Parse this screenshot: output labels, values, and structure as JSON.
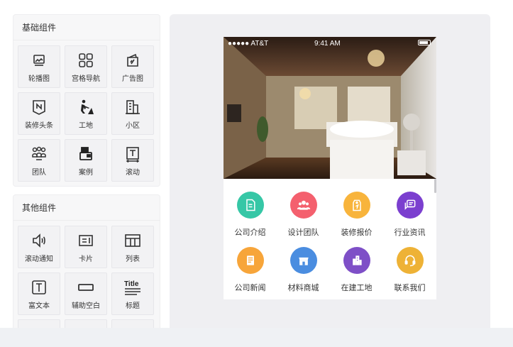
{
  "sidebar": {
    "basic": {
      "title": "基础组件",
      "items": [
        {
          "label": "轮播图",
          "icon": "carousel-icon"
        },
        {
          "label": "宫格导航",
          "icon": "grid-nav-icon"
        },
        {
          "label": "广告图",
          "icon": "ad-image-icon"
        },
        {
          "label": "装修头条",
          "icon": "headline-icon"
        },
        {
          "label": "工地",
          "icon": "construction-worker-icon"
        },
        {
          "label": "小区",
          "icon": "building-icon"
        },
        {
          "label": "团队",
          "icon": "team-icon"
        },
        {
          "label": "案例",
          "icon": "case-icon"
        },
        {
          "label": "滚动",
          "icon": "scroll-text-icon"
        }
      ]
    },
    "other": {
      "title": "其他组件",
      "items": [
        {
          "label": "滚动通知",
          "icon": "speaker-icon"
        },
        {
          "label": "卡片",
          "icon": "card-icon"
        },
        {
          "label": "列表",
          "icon": "list-layout-icon"
        },
        {
          "label": "富文本",
          "icon": "rich-text-icon"
        },
        {
          "label": "辅助空白",
          "icon": "blank-space-icon"
        },
        {
          "label": "标题",
          "icon": "title-icon"
        }
      ]
    }
  },
  "preview": {
    "status_bar": {
      "carrier": "●●●●● AT&T",
      "time": "9:41 AM"
    },
    "nav_items": [
      {
        "label": "公司介绍",
        "color": "#36c7a6",
        "icon": "document-icon"
      },
      {
        "label": "设计团队",
        "color": "#f4606e",
        "icon": "users-icon"
      },
      {
        "label": "装修报价",
        "color": "#f8b43c",
        "icon": "price-tag-icon"
      },
      {
        "label": "行业资讯",
        "color": "#7b3fcf",
        "icon": "chat-icon"
      },
      {
        "label": "公司新闻",
        "color": "#f7a53a",
        "icon": "newspaper-icon"
      },
      {
        "label": "材料商城",
        "color": "#4a8de0",
        "icon": "store-icon"
      },
      {
        "label": "在建工地",
        "color": "#7e4fc7",
        "icon": "city-icon"
      },
      {
        "label": "联系我们",
        "color": "#eeb236",
        "icon": "headset-icon"
      }
    ]
  }
}
